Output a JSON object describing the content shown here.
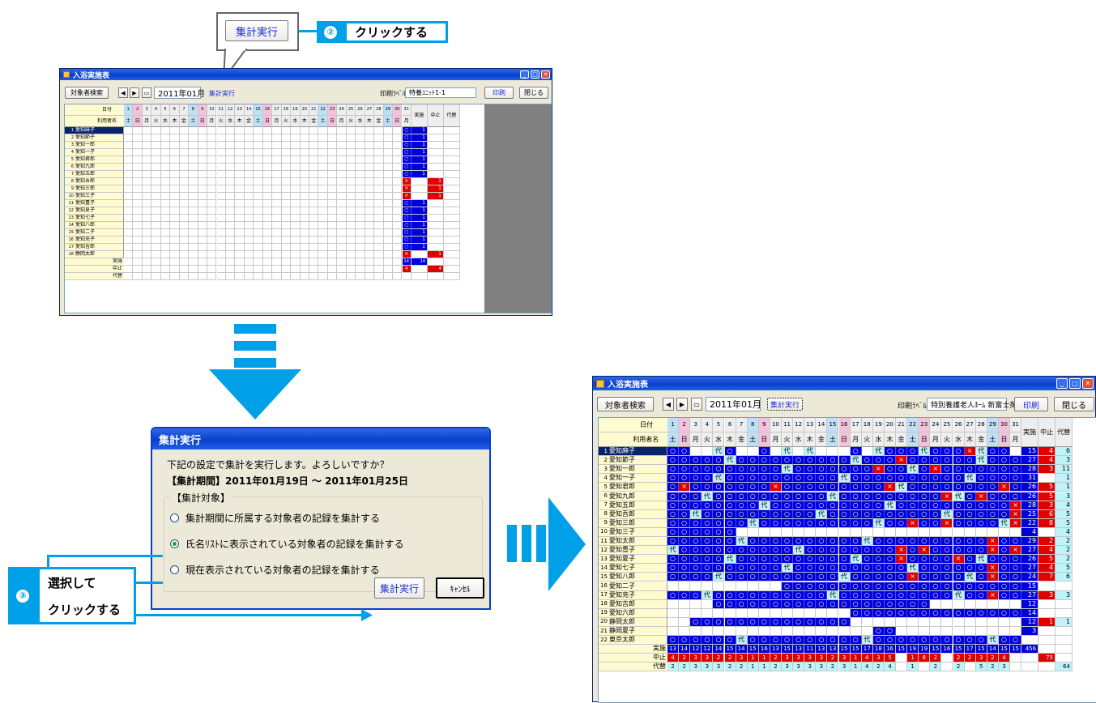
{
  "window": {
    "title": "入浴実施表",
    "search_button": "対象者検索",
    "date": "2011年01月",
    "run_button": "集計実行",
    "print_label": "印刷ﾗﾍﾞﾙ",
    "print_value_top": "特養ﾕﾆｯﾄ1-1",
    "print_value_result": "特別養護老人ﾎｰﾑ 新富士苑",
    "print_button": "印刷",
    "close_button": "閉じる"
  },
  "grid": {
    "header_date": "日付",
    "header_user": "利用者名",
    "days": [
      "1",
      "2",
      "3",
      "4",
      "5",
      "6",
      "7",
      "8",
      "9",
      "10",
      "11",
      "12",
      "13",
      "14",
      "15",
      "16",
      "17",
      "18",
      "19",
      "20",
      "21",
      "22",
      "23",
      "24",
      "25",
      "26",
      "27",
      "28",
      "29",
      "30",
      "31"
    ],
    "weekdays": [
      "土",
      "日",
      "月",
      "火",
      "水",
      "木",
      "金",
      "土",
      "日",
      "月",
      "火",
      "水",
      "木",
      "金",
      "土",
      "日",
      "月",
      "火",
      "水",
      "木",
      "金",
      "土",
      "日",
      "月",
      "火",
      "水",
      "木",
      "金",
      "土",
      "日",
      "月"
    ],
    "col_done": "実施",
    "col_cancel": "中止",
    "col_sub": "代替",
    "summary_labels": [
      "実施",
      "中止",
      "代替"
    ],
    "users_top": [
      "愛知麻子",
      "愛知節子",
      "愛知一郎",
      "愛知一子",
      "愛知君郎",
      "愛知九郎",
      "愛知五郎",
      "愛知吾郎",
      "愛知三郎",
      "愛知三子",
      "愛知豊子",
      "愛知夏子",
      "愛知七子",
      "愛知八郎",
      "愛知二子",
      "愛知充子",
      "愛知吉郎",
      "静岡太郎"
    ],
    "users_result": [
      "愛知麻子",
      "愛知節子",
      "愛知一郎",
      "愛知一子",
      "愛知君郎",
      "愛知九郎",
      "愛知五郎",
      "愛知吾郎",
      "愛知三郎",
      "愛知三子",
      "愛知太郎",
      "愛知豊子",
      "愛知夏子",
      "愛知七子",
      "愛知八郎",
      "愛知二子",
      "愛知充子",
      "愛知吉郎",
      "愛知六郎",
      "静岡太郎",
      "静岡夏子",
      "東京太郎"
    ],
    "top_last_col": [
      "O",
      "O",
      "O",
      "O",
      "O",
      "O",
      "O",
      "X",
      "X",
      "X",
      "O",
      "O",
      "O",
      "O",
      "O",
      "O",
      "O",
      "X"
    ],
    "top_done": [
      "1",
      "1",
      "1",
      "1",
      "1",
      "1",
      "1",
      "",
      "",
      "",
      "1",
      "1",
      "1",
      "1",
      "1",
      "1",
      "1",
      ""
    ],
    "top_cancel": [
      "",
      "",
      "",
      "",
      "",
      "",
      "",
      "1",
      "1",
      "1",
      "",
      "",
      "",
      "",
      "",
      "",
      "",
      "1"
    ],
    "top_summary": {
      "done_day": "14",
      "done_total": "14",
      "cancel_day": "4",
      "cancel_total": "4"
    },
    "result_done": [
      "15",
      "27",
      "28",
      "31",
      "26",
      "26",
      "28",
      "25",
      "22",
      "4",
      "29",
      "27",
      "26",
      "27",
      "24",
      "15",
      "27",
      "12",
      "14",
      "12",
      "3"
    ],
    "result_cancel": [
      "4",
      "4",
      "3",
      "",
      "5",
      "5",
      "3",
      "6",
      "8",
      "",
      "2",
      "4",
      "5",
      "4",
      "7",
      "",
      "3",
      "",
      "",
      "1",
      ""
    ],
    "result_sub": [
      "6",
      "3",
      "11",
      "1",
      "1",
      "3",
      "4",
      "5",
      "5",
      "4",
      "2",
      "2",
      "2",
      "5",
      "6",
      "",
      "3",
      "",
      "",
      "1",
      ""
    ],
    "result_summary_done": [
      "13",
      "14",
      "12",
      "12",
      "14",
      "15",
      "14",
      "15",
      "16",
      "13",
      "15",
      "13",
      "11",
      "13",
      "13",
      "15",
      "15",
      "17",
      "18",
      "16",
      "15",
      "19",
      "19",
      "15",
      "16",
      "15",
      "17",
      "15",
      "14",
      "15",
      "15"
    ],
    "result_summary_cancel": [
      "4",
      "2",
      "3",
      "3",
      "2",
      "2",
      "3",
      "1",
      "1",
      "2",
      "3",
      "3",
      "3",
      "3",
      "2",
      "3",
      "1",
      "4",
      "3",
      "5",
      "",
      "1",
      "8",
      "2",
      "",
      "2",
      "2",
      "3",
      "2",
      "4",
      ""
    ],
    "result_summary_sub": [
      "2",
      "2",
      "3",
      "3",
      "3",
      "2",
      "2",
      "1",
      "1",
      "2",
      "3",
      "3",
      "3",
      "3",
      "2",
      "3",
      "1",
      "4",
      "2",
      "4",
      "",
      "1",
      "",
      "2",
      "",
      "2",
      "",
      "5",
      "2",
      "3",
      ""
    ],
    "result_totals": {
      "done": "456",
      "cancel": "75",
      "sub": "64"
    },
    "symbol_o": "○",
    "symbol_x": "×",
    "symbol_sub": "代"
  },
  "callouts": {
    "button_zoom": "集計実行",
    "step2_num": "②",
    "step2_text": "クリックする",
    "step3_num": "③",
    "step3_line1": "選択して",
    "step3_line2": "クリックする"
  },
  "dialog": {
    "title": "集計実行",
    "message": "下記の設定で集計を実行します。よろしいですか？",
    "period": "【集計期間】2011年01月19日 ～ 2011年01月25日",
    "group_label": "【集計対象】",
    "options": [
      "集計期間に所属する対象者の記録を集計する",
      "氏名ﾘｽﾄに表示されている対象者の記録を集計する",
      "現在表示されている対象者の記録を集計する"
    ],
    "selected_index": 1,
    "ok_button": "集計実行",
    "cancel_button": "ｷｬﾝｾﾙ"
  },
  "colors": {
    "accent": "#00A0E9",
    "blue": "#0000D8",
    "red": "#E00000",
    "cyan": "#BDF3FA",
    "title": "#0A3FCB"
  }
}
